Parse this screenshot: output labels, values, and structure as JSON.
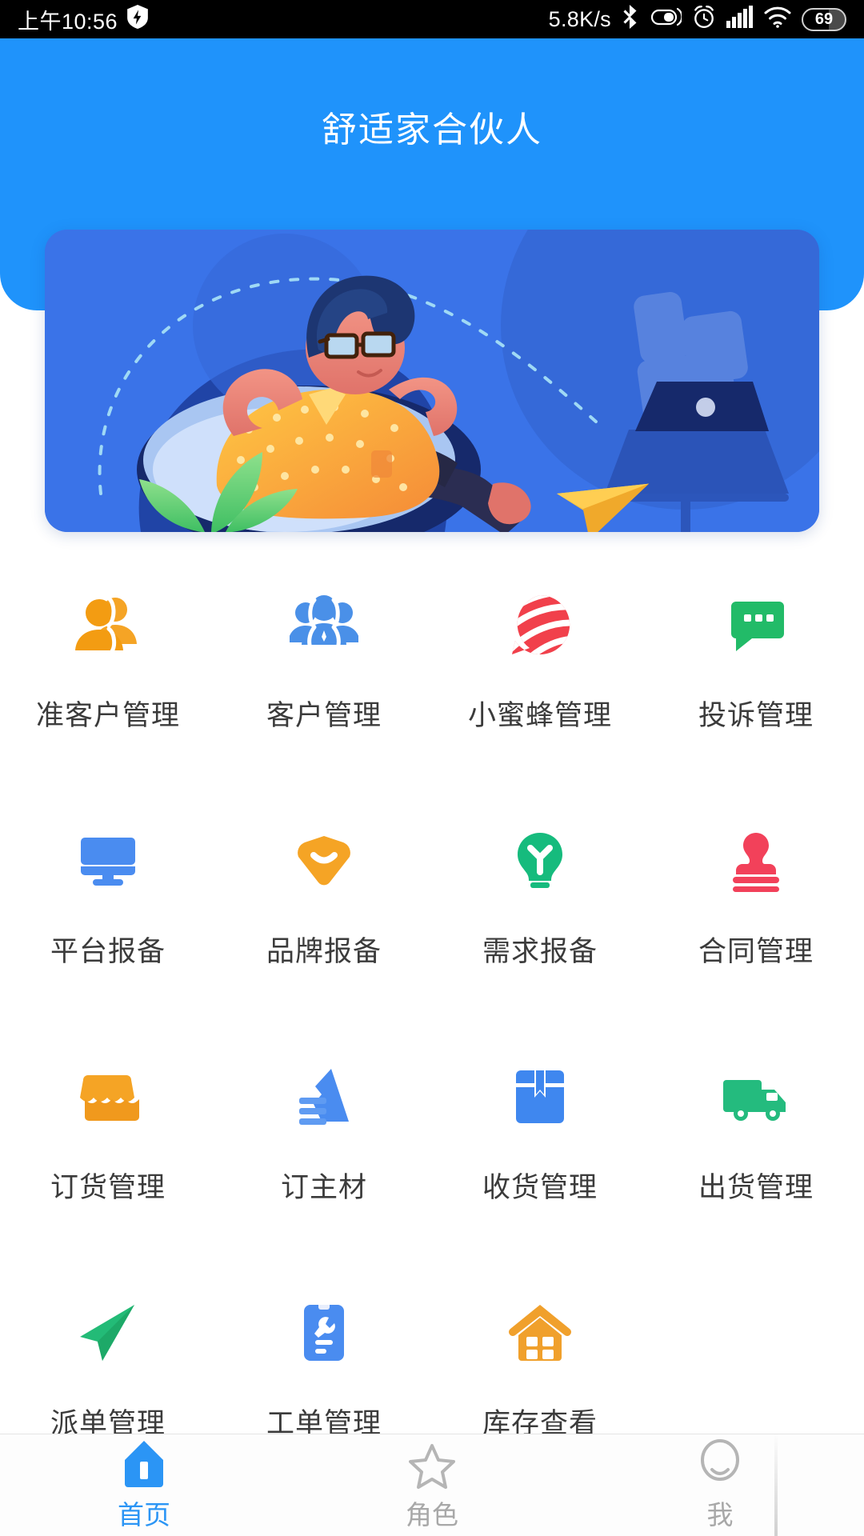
{
  "statusbar": {
    "time": "上午10:56",
    "shield_icon": "shield-icon",
    "network_speed": "5.8K/s",
    "bluetooth_icon": "bluetooth-icon",
    "dnd_icon": "do-not-disturb-icon",
    "alarm_icon": "alarm-clock-icon",
    "signal_icon": "cellular-signal-icon",
    "wifi_icon": "wifi-icon",
    "battery_level": "69"
  },
  "header": {
    "title": "舒适家合伙人",
    "bg_color": "#1f93fb"
  },
  "banner": {
    "name": "hero-illustration-banner",
    "bg_color": "#3a73e8",
    "alt": "插画：戴眼镜的人靠在懒人沙发上休息，旁边有纸飞机与笔记本电脑"
  },
  "grid": {
    "items": [
      {
        "label": "准客户管理",
        "icon": "two-people-icon",
        "color": "#f5a425"
      },
      {
        "label": "客户管理",
        "icon": "people-group-icon",
        "color": "#4a90e8"
      },
      {
        "label": "小蜜蜂管理",
        "icon": "striped-bee-icon",
        "color": "#f1404b"
      },
      {
        "label": "投诉管理",
        "icon": "chat-bubble-icon",
        "color": "#22bb68"
      },
      {
        "label": "平台报备",
        "icon": "monitor-icon",
        "color": "#4a8cf0"
      },
      {
        "label": "品牌报备",
        "icon": "shield-chevron-icon",
        "color": "#f5a425"
      },
      {
        "label": "需求报备",
        "icon": "lightbulb-icon",
        "color": "#16bb7d"
      },
      {
        "label": "合同管理",
        "icon": "stamp-icon",
        "color": "#f2415a"
      },
      {
        "label": "订货管理",
        "icon": "shop-awning-icon",
        "color": "#f5a425"
      },
      {
        "label": "订主材",
        "icon": "material-flag-icon",
        "color": "#4a8cf0"
      },
      {
        "label": "收货管理",
        "icon": "package-box-icon",
        "color": "#3f87ef"
      },
      {
        "label": "出货管理",
        "icon": "delivery-truck-icon",
        "color": "#24bb7e"
      },
      {
        "label": "派单管理",
        "icon": "paper-plane-icon",
        "color": "#23bb77"
      },
      {
        "label": "工单管理",
        "icon": "phone-wrench-icon",
        "color": "#4a8cf0"
      },
      {
        "label": "库存查看",
        "icon": "house-icon",
        "color": "#f0a02c"
      }
    ]
  },
  "tabbar": {
    "active_color": "#2b95f5",
    "inactive_color": "#a8a8a8",
    "items": [
      {
        "label": "首页",
        "icon": "home-icon",
        "active": true
      },
      {
        "label": "角色",
        "icon": "star-icon",
        "active": false
      },
      {
        "label": "我",
        "icon": "person-icon",
        "active": false
      }
    ]
  }
}
